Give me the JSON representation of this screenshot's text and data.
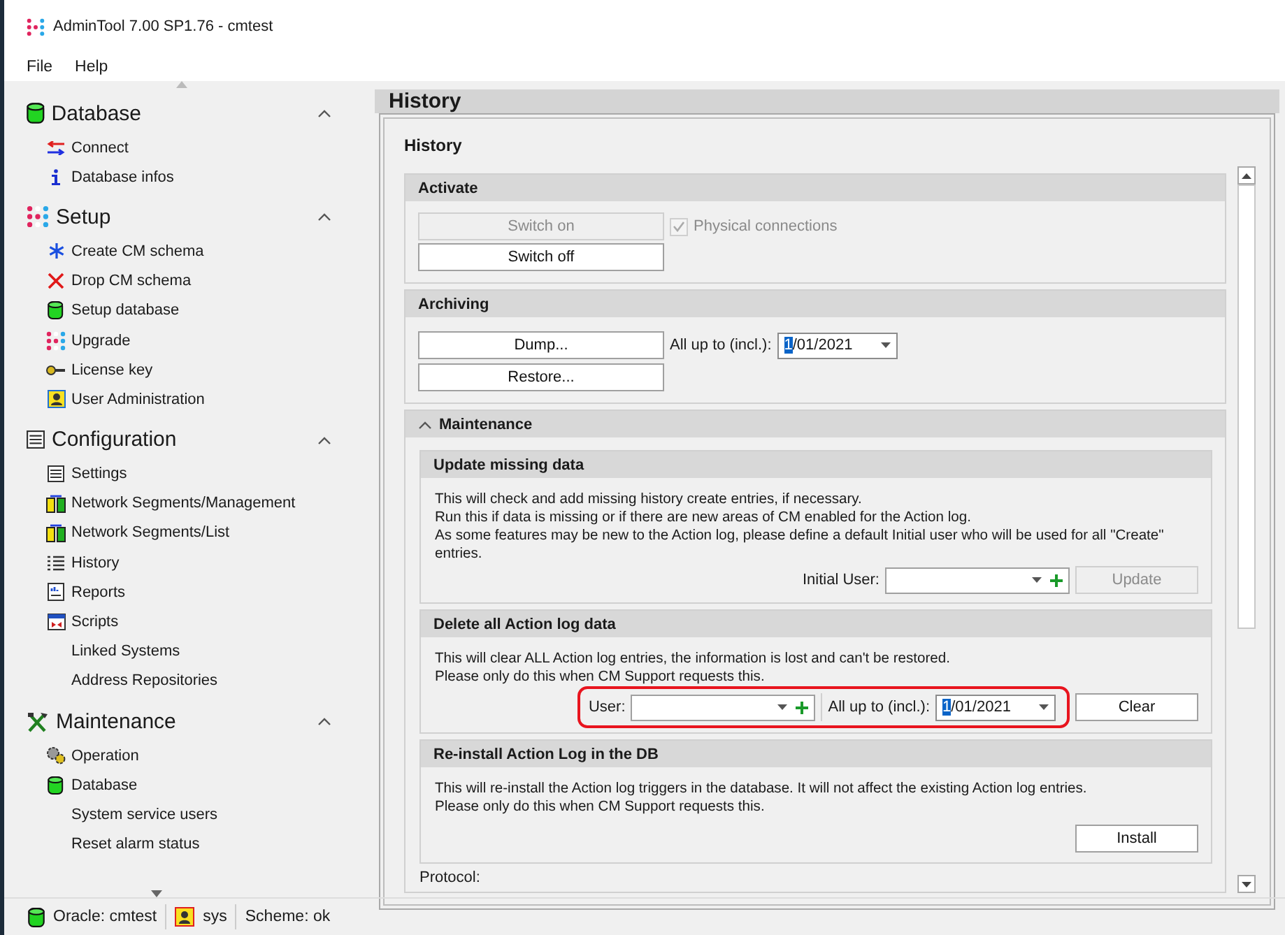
{
  "window": {
    "title": "AdminTool 7.00 SP1.76 - cmtest"
  },
  "menu": [
    "File",
    "Help"
  ],
  "sidebar": {
    "sections": [
      {
        "title": "Database",
        "expanded": true,
        "items": [
          "Connect",
          "Database infos"
        ]
      },
      {
        "title": "Setup",
        "expanded": true,
        "items": [
          "Create CM schema",
          "Drop CM schema",
          "Setup database",
          "Upgrade",
          "License key",
          "User Administration"
        ]
      },
      {
        "title": "Configuration",
        "expanded": true,
        "items": [
          "Settings",
          "Network Segments/Management",
          "Network Segments/List",
          "History",
          "Reports",
          "Scripts",
          "Linked Systems",
          "Address Repositories"
        ]
      },
      {
        "title": "Maintenance",
        "expanded": true,
        "items": [
          "Operation",
          "Database",
          "System service users",
          "Reset alarm status"
        ]
      }
    ]
  },
  "page": {
    "title": "History",
    "heading": "History",
    "activate": {
      "title": "Activate",
      "switch_on": {
        "label": "Switch on",
        "disabled": true
      },
      "switch_off": {
        "label": "Switch off",
        "disabled": false
      },
      "physical": {
        "label": "Physical connections",
        "checked": true,
        "disabled": true
      }
    },
    "archiving": {
      "title": "Archiving",
      "dump": "Dump...",
      "restore": "Restore...",
      "date_label": "All up to (incl.):",
      "date": "1/01/2021"
    },
    "maintenance": {
      "title": "Maintenance",
      "expanded": true,
      "update": {
        "title": "Update missing data",
        "lines": [
          "This will check and add missing history create entries, if necessary.",
          "Run this if data is missing or if there are new areas of CM enabled for the Action log.",
          "As some features may be new to the Action log, please define a default Initial user who will be used for all \"Create\" entries."
        ],
        "user_label": "Initial User:",
        "button": {
          "label": "Update",
          "disabled": true
        }
      },
      "delete": {
        "title": "Delete all Action log data",
        "lines": [
          "This will clear ALL Action log entries, the information is lost and can't be restored.",
          "Please only do this when CM Support requests this."
        ],
        "user_label": "User:",
        "date_label": "All up to (incl.):",
        "date": "1/01/2021",
        "highlighted": true,
        "button": "Clear"
      },
      "reinstall": {
        "title": "Re-install Action Log in the DB",
        "lines": [
          "This will re-install the Action log triggers in the database. It will not affect the existing Action log entries.",
          "Please only do this when CM Support requests this."
        ],
        "button": "Install"
      }
    },
    "protocol_label": "Protocol:"
  },
  "status_bar": [
    "Oracle: cmtest",
    "sys",
    "Scheme: ok"
  ]
}
